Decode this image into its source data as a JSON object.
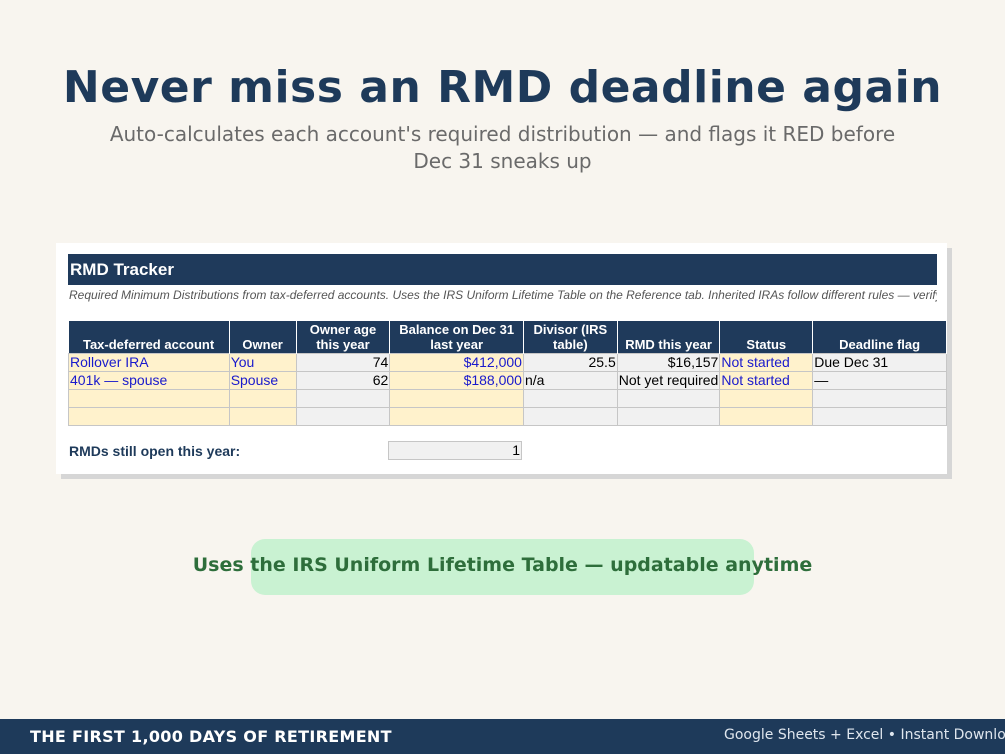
{
  "headline": "Never miss an RMD deadline again",
  "subhead": "Auto-calculates each account's required distribution — and flags it RED before Dec 31 sneaks up",
  "sheet": {
    "title": "RMD Tracker",
    "note": "Required Minimum Distributions from tax-deferred accounts. Uses the IRS Uniform Lifetime Table on the Reference tab. Inherited IRAs follow different rules — verify with your custodian.",
    "columns": [
      "Tax-deferred account",
      "Owner",
      "Owner age this year",
      "Balance on Dec 31 last year",
      "Divisor (IRS table)",
      "RMD this year",
      "Status",
      "Deadline flag"
    ],
    "rows": [
      {
        "account": "Rollover IRA",
        "owner": "You",
        "age": "74",
        "balance": "$412,000",
        "divisor": "25.5",
        "rmd": "$16,157",
        "status": "Not started",
        "flag": "Due Dec 31"
      },
      {
        "account": "401k — spouse",
        "owner": "Spouse",
        "age": "62",
        "balance": "$188,000",
        "divisor": "n/a",
        "rmd": "Not yet required",
        "status": "Not started",
        "flag": "—"
      },
      {
        "account": "",
        "owner": "",
        "age": "",
        "balance": "",
        "divisor": "",
        "rmd": "",
        "status": "",
        "flag": ""
      },
      {
        "account": "",
        "owner": "",
        "age": "",
        "balance": "",
        "divisor": "",
        "rmd": "",
        "status": "",
        "flag": ""
      }
    ],
    "summary_label": "RMDs still open this year:",
    "summary_value": "1"
  },
  "pill": "Uses the IRS Uniform Lifetime Table — updatable anytime",
  "footer": {
    "brand": "THE FIRST 1,000 DAYS OF RETIREMENT",
    "right": "Google Sheets + Excel  •  Instant Download"
  },
  "colors": {
    "navy": "#1f3a5b",
    "input_fill": "#fff2cc",
    "input_text": "#1a1acc",
    "calc_fill": "#f1f1f1",
    "pill_fill": "#c9f2d2",
    "pill_text": "#2e6e3b",
    "background": "#f8f5ef"
  }
}
